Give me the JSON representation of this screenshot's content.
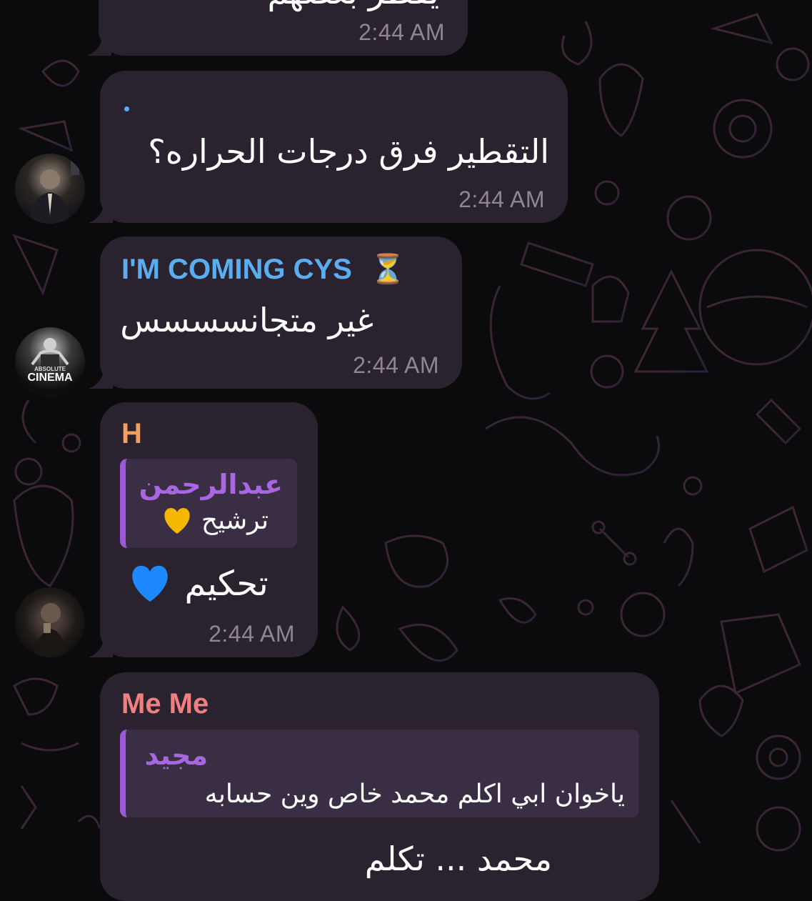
{
  "colors": {
    "background": "#0b0a0d",
    "bubble": "#2b2230",
    "reply_bg": "#3a2e45",
    "reply_bar": "#9b59d9",
    "reply_name": "#a867e0",
    "time": "#8e8693",
    "sender_blue": "#5aaef0",
    "sender_orange": "#f0a05a",
    "sender_pink": "#f08080",
    "link_dot": "#5aaef0"
  },
  "messages": [
    {
      "id": "m1",
      "text": "يقطر بعضهم",
      "time": "2:44 AM"
    },
    {
      "id": "m2",
      "text": "التقطير فرق درجات الحراره؟",
      "time": "2:44 AM",
      "avatar_icon": "person-in-suit-avatar"
    },
    {
      "id": "m3",
      "sender": "I'M COMING CYS",
      "sender_emoji": "⏳",
      "text": "غير متجانسسسس",
      "time": "2:44 AM",
      "avatar_label": "CINEMA",
      "avatar_sublabel": "ABSOLUTE"
    },
    {
      "id": "m4",
      "sender": "H",
      "reply_name": "عبدالرحمن",
      "reply_text": "ترشيح",
      "reply_icon": "yellow-heart-icon",
      "text": "تحكيم",
      "text_icon": "blue-heart-icon",
      "time": "2:44 AM",
      "avatar_icon": "person-photo-avatar"
    },
    {
      "id": "m5",
      "sender": "Me Me",
      "reply_name": "مجيد",
      "reply_text": "ياخوان ابي اكلم محمد خاص وين حسابه",
      "text": "محمد ... تكلم"
    }
  ]
}
